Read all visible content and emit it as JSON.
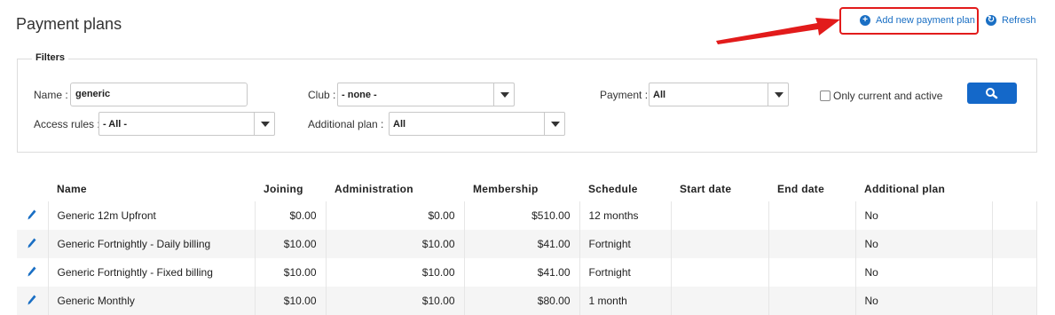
{
  "header": {
    "title": "Payment plans",
    "add_label": "Add new payment plan",
    "refresh_label": "Refresh"
  },
  "filters": {
    "legend": "Filters",
    "name_label": "Name :",
    "name_value": "generic",
    "club_label": "Club :",
    "club_value": "- none -",
    "payment_label": "Payment :",
    "payment_value": "All",
    "only_current_label": "Only current and active",
    "access_label": "Access rules :",
    "access_value": "- All -",
    "additional_label": "Additional plan :",
    "additional_value": "All"
  },
  "table": {
    "headers": [
      "Name",
      "Joining",
      "Administration",
      "Membership",
      "Schedule",
      "Start date",
      "End date",
      "Additional plan"
    ],
    "rows": [
      {
        "name": "Generic 12m Upfront",
        "joining": "$0.00",
        "administration": "$0.00",
        "membership": "$510.00",
        "schedule": "12 months",
        "start": "",
        "end": "",
        "additional": "No"
      },
      {
        "name": "Generic Fortnightly - Daily billing",
        "joining": "$10.00",
        "administration": "$10.00",
        "membership": "$41.00",
        "schedule": "Fortnight",
        "start": "",
        "end": "",
        "additional": "No"
      },
      {
        "name": "Generic Fortnightly - Fixed billing",
        "joining": "$10.00",
        "administration": "$10.00",
        "membership": "$41.00",
        "schedule": "Fortnight",
        "start": "",
        "end": "",
        "additional": "No"
      },
      {
        "name": "Generic Monthly",
        "joining": "$10.00",
        "administration": "$10.00",
        "membership": "$80.00",
        "schedule": "1 month",
        "start": "",
        "end": "",
        "additional": "No"
      }
    ]
  },
  "colors": {
    "accent": "#1468c9",
    "annotation": "#e21b1b"
  }
}
